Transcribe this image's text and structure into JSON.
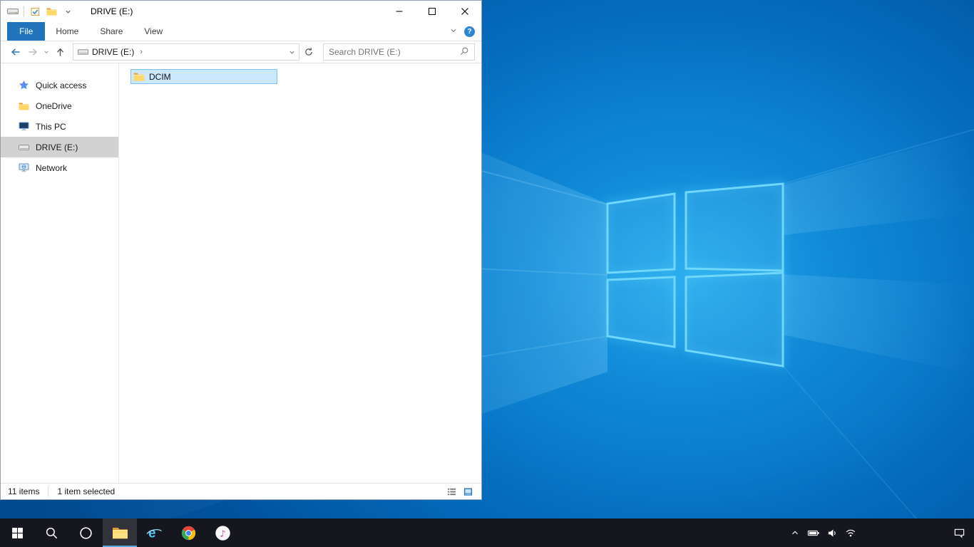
{
  "explorer": {
    "title": "DRIVE (E:)",
    "ribbon": {
      "file": "File",
      "home": "Home",
      "share": "Share",
      "view": "View",
      "help": "?"
    },
    "nav": {
      "address": "DRIVE (E:)",
      "breadcrumb_sep": "›",
      "search_placeholder": "Search DRIVE (E:)"
    },
    "sidebar": {
      "items": [
        {
          "label": "Quick access",
          "icon": "star-icon"
        },
        {
          "label": "OneDrive",
          "icon": "onedrive-folder-icon"
        },
        {
          "label": "This PC",
          "icon": "monitor-icon"
        },
        {
          "label": "DRIVE (E:)",
          "icon": "drive-icon",
          "selected": true
        },
        {
          "label": "Network",
          "icon": "network-icon"
        }
      ]
    },
    "content": {
      "items": [
        {
          "name": "DCIM",
          "icon": "folder-icon",
          "selected": true
        }
      ]
    },
    "statusbar": {
      "items_count": "11 items",
      "selected_count": "1 item selected"
    }
  },
  "taskbar": {
    "apps": [
      "start",
      "search",
      "cortana",
      "file-explorer",
      "internet-explorer",
      "chrome",
      "itunes"
    ],
    "tray": [
      "show-hidden-icons",
      "battery",
      "volume",
      "wifi",
      "action-center"
    ]
  },
  "colors": {
    "accent": "#2074bc",
    "file_selection_bg": "#cce8ff",
    "file_selection_border": "#7fc1f5",
    "sidebar_selection": "#d2d2d2",
    "taskbar_bg": "#16161f",
    "wallpaper_blue": "#0469ba",
    "logo_glow": "#6fd8fa"
  }
}
